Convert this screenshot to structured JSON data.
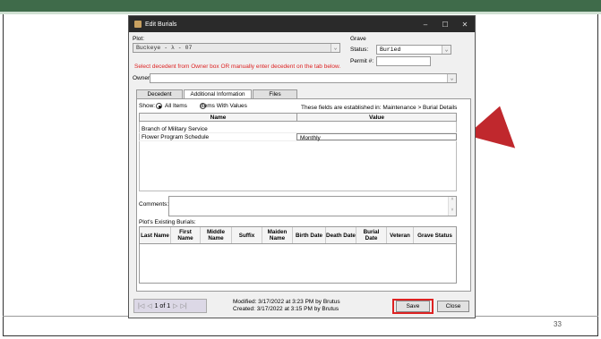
{
  "window": {
    "title": "Edit Burials",
    "controls": {
      "minimize": "–",
      "maximize": "☐",
      "close": "✕"
    }
  },
  "plot": {
    "label": "Plot:",
    "value": "Buckeye - λ - 07"
  },
  "grave": {
    "label": "Grave",
    "status_label": "Status:",
    "status_value": "Buried",
    "permit_label": "Permit #:",
    "permit_value": ""
  },
  "note": "Select decedent from Owner box OR manually enter decedent on the tab below.",
  "owner": {
    "label": "Owner:",
    "value": ""
  },
  "tabs": [
    {
      "label": "Decedent",
      "active": false
    },
    {
      "label": "Additional Information",
      "active": true
    },
    {
      "label": "Files",
      "active": false
    }
  ],
  "show": {
    "label": "Show:",
    "option_all": "All Items",
    "option_values": "Items With Values",
    "selected": "All Items",
    "info": "These fields are established in: Maintenance > Burial Details"
  },
  "info_grid": {
    "headers": [
      "Name",
      "Value"
    ],
    "rows": [
      {
        "name": "Branch of Military Service",
        "value": ""
      },
      {
        "name": "Flower Program Schedule",
        "value": "Monthly"
      }
    ]
  },
  "comments": {
    "label": "Comments:",
    "value": ""
  },
  "existing_burials": {
    "label": "Plot's Existing Burials:",
    "headers": [
      "Last Name",
      "First Name",
      "Middle Name",
      "Suffix",
      "Maiden Name",
      "Birth Date",
      "Death Date",
      "Burial Date",
      "Veteran",
      "Grave Status"
    ]
  },
  "pager": {
    "text": "1 of 1"
  },
  "audit": {
    "modified": "Modified: 3/17/2022 at 3:23 PM by Brutus",
    "created": "Created: 3/17/2022 at 3:15 PM by Brutus"
  },
  "buttons": {
    "save": "Save",
    "close": "Close"
  },
  "slide": {
    "page_number": "33"
  },
  "colors": {
    "accent_green": "#3f6b4a",
    "highlight_red": "#d22222",
    "arrow_red": "#c0282d"
  }
}
